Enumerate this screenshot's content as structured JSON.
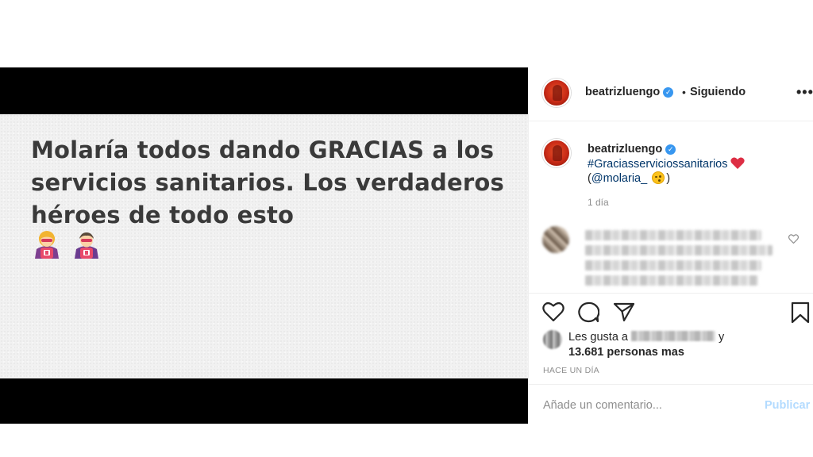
{
  "post_image": {
    "text": "Molaría todos dando GRACIAS a los servicios sanitarios. Los verdaderos héroes de todo esto",
    "emojis": [
      "woman-superhero",
      "man-superhero"
    ]
  },
  "header": {
    "username": "beatrizluengo",
    "separator": "•",
    "follow_status": "Siguiendo",
    "more": "•••"
  },
  "caption": {
    "username": "beatrizluengo",
    "hashtag": "#Graciasserviciossanitarios",
    "mention_open": "(",
    "mention": "@molaria_",
    "mention_close": ")",
    "time": "1 día"
  },
  "likes": {
    "prefix": "Les gusta a",
    "suffix": "y",
    "count_text": "13.681 personas mas"
  },
  "post_time": "HACE UN DÍA",
  "comment_box": {
    "placeholder": "Añade un comentario...",
    "publish": "Publicar"
  },
  "colors": {
    "link": "#003569",
    "verified": "#3897f0",
    "publish_disabled": "#b3dbff",
    "muted": "#8e8e8e"
  }
}
